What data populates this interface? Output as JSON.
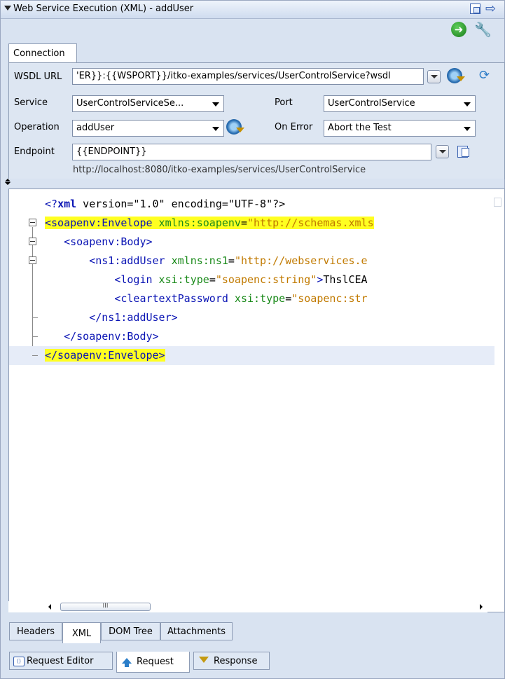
{
  "window": {
    "title": "Web Service Execution (XML) - addUser"
  },
  "icons": {
    "collapse": "triangle-down-icon",
    "detach": "detach-window-icon",
    "forward": "arrow-right-icon",
    "run": "green-go-icon",
    "settings": "wrench-icon",
    "gear": "gear-icon",
    "refresh": "refresh-icon",
    "copy": "copy-icon"
  },
  "connection": {
    "tab_label": "Connection",
    "wsdl_label": "WSDL URL",
    "wsdl_value": "'ER}}:{{WSPORT}}/itko-examples/services/UserControlService?wsdl",
    "service_label": "Service",
    "service_value": "UserControlServiceSe...",
    "port_label": "Port",
    "port_value": "UserControlService",
    "operation_label": "Operation",
    "operation_value": "addUser",
    "onerror_label": "On Error",
    "onerror_value": "Abort the Test",
    "endpoint_label": "Endpoint",
    "endpoint_value": "{{ENDPOINT}}",
    "endpoint_hint": "http://localhost:8080/itko-examples/services/UserControlService"
  },
  "xml": {
    "l1_a": "<?",
    "l1_b": "xml",
    "l1_c": " version=\"1.0\" encoding=\"UTF-8\"?>",
    "l2_tag": "<soapenv:Envelope",
    "l2_attr": " xmlns:soapenv",
    "l2_eq": "=",
    "l2_val": "\"http://schemas.xmls",
    "l3_tag": "<soapenv:Body>",
    "l4_tag": "<ns1:addUser",
    "l4_attr": " xmlns:ns1",
    "l4_eq": "=",
    "l4_val": "\"http://webservices.e",
    "l5_tag": "<login",
    "l5_attr": " xsi:type",
    "l5_eq": "=",
    "l5_val": "\"soapenc:string\"",
    "l5_tag2": ">",
    "l5_txt": "ThslCEA",
    "l6_tag": "<cleartextPassword",
    "l6_attr": " xsi:type",
    "l6_eq": "=",
    "l6_val": "\"soapenc:str",
    "l7_tag": "</ns1:addUser>",
    "l8_tag": "</soapenv:Body>",
    "l9_tag": "</soapenv:Envelope>"
  },
  "scrollbar": {
    "thumb_grip": "III"
  },
  "view_tabs": [
    "Headers",
    "XML",
    "DOM Tree",
    "Attachments"
  ],
  "bottom_tabs": [
    "Request Editor",
    "Request",
    "Response"
  ]
}
